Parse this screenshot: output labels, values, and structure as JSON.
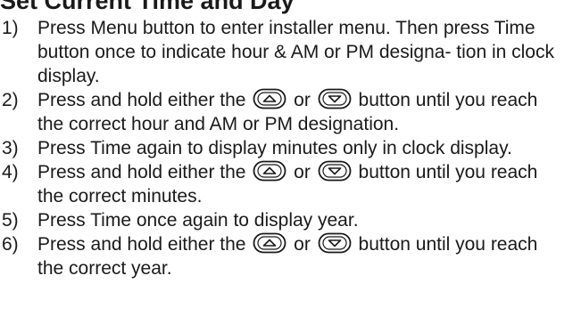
{
  "title": "Set Current Time and Day",
  "steps": [
    {
      "num": "1)",
      "text": "Press Menu button to enter installer menu. Then press Time button once to indicate hour & AM or PM designa- tion in clock display."
    },
    {
      "num": "2)",
      "pre": "Press and hold either the",
      "mid": "or",
      "post": "button until you reach the correct hour and AM or PM designation."
    },
    {
      "num": "3)",
      "text": "Press Time again to display minutes only in clock display."
    },
    {
      "num": "4)",
      "pre": "Press and hold either the",
      "mid": "or",
      "post": "button until you reach the correct minutes."
    },
    {
      "num": "5)",
      "text": "Press Time once again to display year."
    },
    {
      "num": "6)",
      "pre": "Press and hold either the",
      "mid": "or",
      "post": "button until you reach the correct year."
    }
  ],
  "icons": {
    "up": "up-arrow-button-icon",
    "down": "down-arrow-button-icon"
  }
}
